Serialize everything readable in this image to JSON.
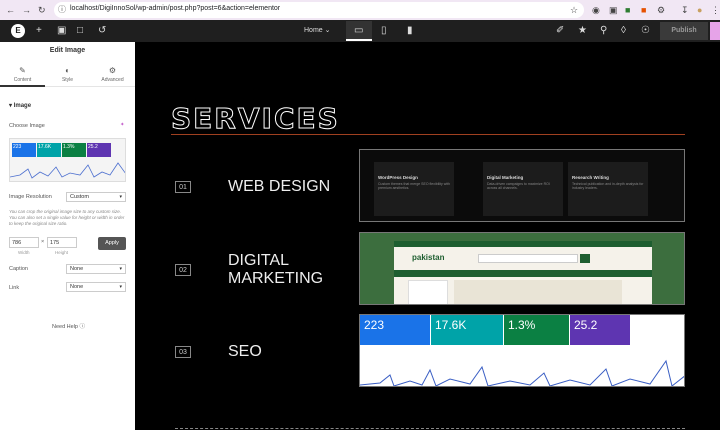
{
  "browser": {
    "url": "localhost/DigiInnoSol/wp-admin/post.php?post=6&action=elementor",
    "nav_icons": [
      "back-arrow-icon",
      "forward-arrow-icon",
      "reload-icon"
    ]
  },
  "topbar": {
    "logo": "E",
    "page_select": "Home",
    "publish_label": "Publish"
  },
  "panel": {
    "title": "Edit Image",
    "tabs": [
      {
        "label": "Content",
        "icon": "pencil-icon"
      },
      {
        "label": "Style",
        "icon": "half-circle-icon"
      },
      {
        "label": "Advanced",
        "icon": "gear-icon"
      }
    ],
    "section": "Image",
    "choose_image": "Choose Image",
    "thumb_stats": [
      "223",
      "17.6K",
      "1.3%",
      "25.2"
    ],
    "resolution_label": "Image Resolution",
    "resolution_value": "Custom",
    "hint": "You can crop the original image size to any custom size. You can also set a single value for height or width in order to keep the original size ratio.",
    "width_value": "786",
    "height_value": "175",
    "width_label": "Width",
    "height_label": "Height",
    "apply_label": "Apply",
    "caption_label": "Caption",
    "caption_value": "None",
    "link_label": "Link",
    "link_value": "None",
    "need_help": "Need Help"
  },
  "canvas": {
    "title": "SERVICES",
    "services": [
      {
        "num": "01",
        "name": "WEB DESIGN"
      },
      {
        "num": "02",
        "name": "DIGITAL MARKETING"
      },
      {
        "num": "03",
        "name": "SEO"
      }
    ],
    "web_cards": [
      {
        "title": "WordPress Design",
        "desc": "Custom themes that merge SEO flexibility with premium aesthetics."
      },
      {
        "title": "Digital Marketing",
        "desc": "Data-driven campaigns to maximize ROI across all channels."
      },
      {
        "title": "Research Writing",
        "desc": "Technical publication and in-depth analysis for industry leaders."
      }
    ],
    "marketing_site": "pakistan",
    "seo_stats": [
      {
        "value": "223",
        "color": "#1a73e8"
      },
      {
        "value": "17.6K",
        "color": "#00a3a8"
      },
      {
        "value": "1.3%",
        "color": "#0b8043"
      },
      {
        "value": "25.2",
        "color": "#5e35b1"
      }
    ]
  }
}
